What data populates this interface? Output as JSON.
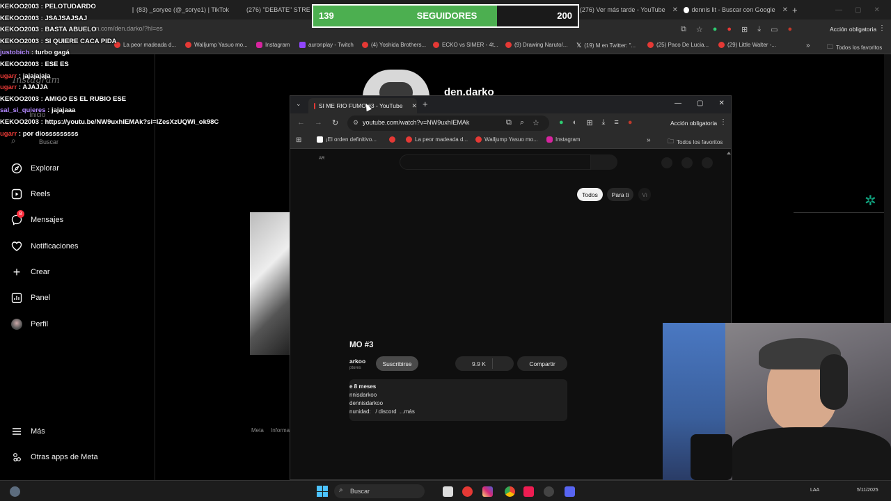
{
  "chat": {
    "lines": [
      {
        "user": "KEKOO2003",
        "msg": "PELOTUDARDO",
        "ucolor": "#ffffff"
      },
      {
        "user": "KEKOO2003",
        "msg": "JSAJSAJSAJ",
        "ucolor": "#ffffff"
      },
      {
        "user": "KEKOO2003",
        "msg": "BASTA ABUELO",
        "ucolor": "#ffffff"
      },
      {
        "user": "KEKOO2003",
        "msg": "SI QUIERE CACA PIDA",
        "ucolor": "#ffffff"
      },
      {
        "user": "justobich",
        "msg": "turbo gagá",
        "ucolor": "#b388ff"
      },
      {
        "user": "KEKOO2003",
        "msg": "ESE ES",
        "ucolor": "#ffffff"
      },
      {
        "user": "ugarr",
        "msg": "jajajajaja",
        "ucolor": "#e53935"
      },
      {
        "user": "ugarr",
        "msg": "AJAJJA",
        "ucolor": "#e53935"
      },
      {
        "user": "KEKOO2003",
        "msg": "AMIGO ES EL RUBIO ESE",
        "ucolor": "#ffffff"
      },
      {
        "user": "sal_si_quieres",
        "msg": "jajajaaa",
        "ucolor": "#b388ff"
      },
      {
        "user": "KEKOO2003",
        "msg": "https://youtu.be/NW9uxhIEMAk?si=IZesXzUQWi_ok98C",
        "ucolor": "#ffffff"
      },
      {
        "user": "ugarr",
        "msg": "por diosssssssss",
        "ucolor": "#e53935"
      }
    ]
  },
  "followers": {
    "current": "139",
    "label": "SEGUIDORES",
    "goal": "200",
    "progress": 0.695,
    "color": "#4caf50"
  },
  "bg_browser": {
    "tabs": [
      {
        "label": "(83) _soryee (@_sorye1) | TikTok"
      },
      {
        "label": "(276) \"DEBATE\" STREAM"
      },
      {
        "label": "ram"
      },
      {
        "label": "(276) Ver más tarde - YouTube"
      },
      {
        "label": "dennis lit - Buscar con Google"
      }
    ],
    "url": "m.com/den.darko/?hl=es",
    "action_label": "Acción obligatoria",
    "bookmarks": [
      "¡El orden definitivo...",
      "La peor madeada d...",
      "Walljump Yasuo mo...",
      "Instagram",
      "auronplay - Twitch",
      "(4) Yoshida Brothers...",
      "ECKO vs SIMER - 4t...",
      "(9) Drawing Naruto/...",
      "(19) M en Twitter: \"...",
      "(25) Paco De Lucia...",
      "(29) Little Walter -..."
    ],
    "favorites_label": "Todos los favoritos"
  },
  "instagram": {
    "logo": "Instagram",
    "inicio": "Inicio",
    "search": "Buscar",
    "profile_name": "den.darko",
    "nav": [
      "Explorar",
      "Reels",
      "Mensajes",
      "Notificaciones",
      "Crear",
      "Panel",
      "Perfil"
    ],
    "messages_badge": "8",
    "more": "Más",
    "meta_apps": "Otras apps de Meta",
    "footer": [
      "Meta",
      "Informa"
    ]
  },
  "yt_browser": {
    "tab_title": "SI ME RIO FUMO #3 - YouTube",
    "url": "youtube.com/watch?v=NW9uxhIEMAk",
    "action_label": "Acción obligatoria",
    "bookmarks": [
      "¡El orden definitivo...",
      "La peor madeada d...",
      "Walljump Yasuo mo...",
      "Instagram"
    ],
    "favorites_label": "Todos los favoritos",
    "country": "AR",
    "chips": [
      "Todos",
      "Para ti",
      "Vi"
    ],
    "video_title": "MO #3",
    "channel": "arkoo",
    "subs": "ptores",
    "subscribe": "Suscribirse",
    "likes": "9.9 K",
    "share": "Compartir",
    "desc": [
      "e 8 meses",
      "nnisdarkoo",
      "dennisdarkoo",
      "nunidad:   / discord  ...más"
    ]
  },
  "taskbar": {
    "search": "Buscar",
    "lang": "LAA",
    "date": "5/11/2025"
  }
}
